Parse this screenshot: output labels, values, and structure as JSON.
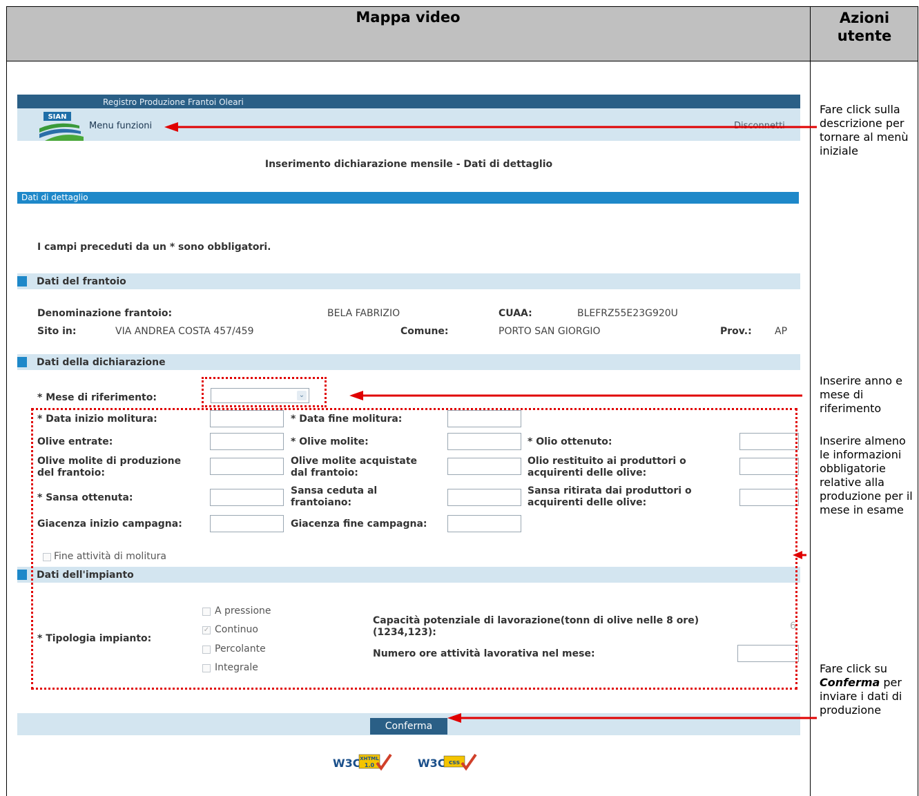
{
  "doc": {
    "header_left": "Mappa video",
    "header_right": "Azioni utente",
    "notes": {
      "note1": "Fare click sulla descrizione per tornare al menù iniziale",
      "note2": "Inserire anno e mese di riferimento",
      "note3": "Inserire almeno le informazioni obbligatorie relative alla produzione per il mese in esame",
      "note4_pre": "Fare click su",
      "note4_bold": "Conferma",
      "note4_post": "per inviare i dati di produzione"
    }
  },
  "app": {
    "title": "Registro Produzione Frantoi Oleari",
    "logo_text": "SIAN",
    "menu_link": "Menu funzioni",
    "disconnect": "Disconnetti",
    "page_title": "Inserimento dichiarazione mensile - Dati di dettaglio",
    "bluebar": "Dati di dettaglio",
    "required_note": "I campi preceduti da un * sono obbligatori."
  },
  "frantoio": {
    "section": "Dati del frantoio",
    "denom_label": "Denominazione frantoio:",
    "denom_value": "BELA FABRIZIO",
    "cuaa_label": "CUAA:",
    "cuaa_value": "BLEFRZ55E23G920U",
    "sito_label": "Sito in:",
    "sito_value": "VIA ANDREA COSTA 457/459",
    "comune_label": "Comune:",
    "comune_value": "PORTO SAN GIORGIO",
    "prov_label": "Prov.:",
    "prov_value": "AP"
  },
  "dichiarazione": {
    "section": "Dati della dichiarazione",
    "mese": "* Mese di riferimento:",
    "data_inizio": "* Data inizio molitura:",
    "data_fine": "* Data fine molitura:",
    "olive_entrate": "Olive entrate:",
    "olive_molite": "* Olive molite:",
    "olio_ottenuto": "* Olio ottenuto:",
    "olive_prod_1": "Olive molite di produzione",
    "olive_prod_2": "del frantoio:",
    "olive_acq_1": "Olive molite acquistate",
    "olive_acq_2": "dal frantoio:",
    "olio_rest_1": "Olio restituito ai produttori o",
    "olio_rest_2": "acquirenti delle olive:",
    "sansa_ottenuta": "* Sansa ottenuta:",
    "sansa_ceduta_1": "Sansa ceduta al",
    "sansa_ceduta_2": "frantoiano:",
    "sansa_rit_1": "Sansa ritirata dai produttori o",
    "sansa_rit_2": "acquirenti delle olive:",
    "giac_inizio": "Giacenza inizio campagna:",
    "giac_fine": "Giacenza fine campagna:",
    "fine_attivita": "Fine attività di molitura"
  },
  "impianto": {
    "section": "Dati dell'impianto",
    "tipologia": "* Tipologia impianto:",
    "opt_pressione": "A pressione",
    "opt_continuo": "Continuo",
    "opt_percolante": "Percolante",
    "opt_integrale": "Integrale",
    "capacita_1": "Capacità potenziale di lavorazione(tonn di olive nelle 8 ore)",
    "capacita_2": "(1234,123):",
    "capacita_value": "6",
    "ore": "Numero ore attività lavorativa nel mese:"
  },
  "buttons": {
    "conferma": "Conferma"
  },
  "badges": {
    "w3c_xhtml_1": "W3C",
    "w3c_xhtml_2": "XHTML",
    "w3c_xhtml_3": "1.0",
    "w3c_css_1": "W3C",
    "w3c_css_2": "css"
  }
}
